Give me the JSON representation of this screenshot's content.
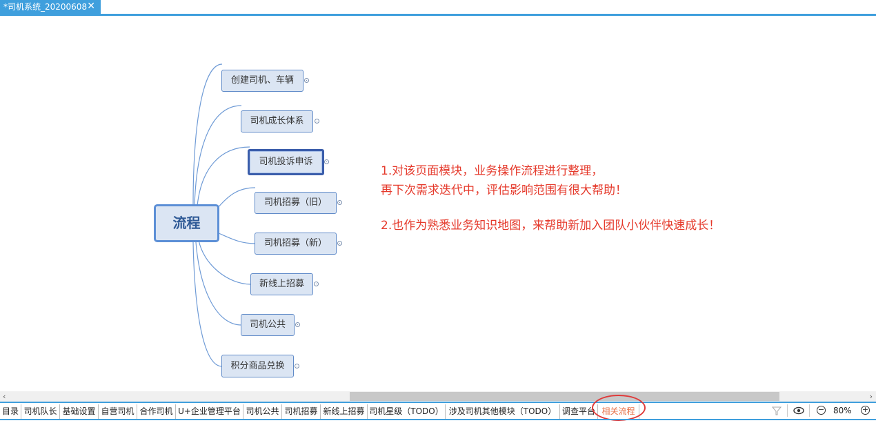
{
  "window": {
    "doc_tab_title": "*司机系统_20200608",
    "close_glyph": "✕"
  },
  "mindmap": {
    "root": "流程",
    "branches": [
      "创建司机、车辆",
      "司机成长体系",
      "司机投诉申诉",
      "司机招募（旧）",
      "司机招募（新）",
      "新线上招募",
      "司机公共",
      "积分商品兑换"
    ],
    "selected_branch": "司机投诉申诉"
  },
  "notes": {
    "line1": "1.对该页面模块，业务操作流程进行整理，",
    "line2": "再下次需求迭代中，评估影响范围有很大帮助！",
    "line3": "2.也作为熟悉业务知识地图，来帮助新加入团队小伙伴快速成长！",
    "color": "#e5392b"
  },
  "scrollbar": {
    "left_arrow": "‹",
    "right_arrow": "›"
  },
  "sheet_tabs": [
    "目录",
    "司机队长",
    "基础设置",
    "自营司机",
    "合作司机",
    "U+企业管理平台",
    "司机公共",
    "司机招募",
    "新线上招募",
    "司机星级（TODO）",
    "涉及司机其他模块（TODO）",
    "调查平台",
    "相关流程"
  ],
  "active_sheet": "相关流程",
  "status": {
    "filter_icon": "filter-icon",
    "eye_icon": "eye-icon",
    "zoom_out": "−",
    "zoom_level": "80%",
    "zoom_in": "+"
  },
  "colors": {
    "accent": "#3f9fdd",
    "node_fill": "#dbe5f3",
    "node_border": "#5f8ac8",
    "highlight": "#e03a3a"
  }
}
